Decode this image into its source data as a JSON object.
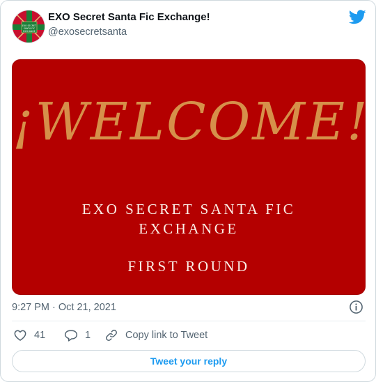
{
  "author": {
    "name": "EXO Secret Santa Fic Exchange!",
    "handle": "@exosecretsanta",
    "avatar_label": "EXO SECRET SANTA FIC EXCHANGE"
  },
  "media": {
    "headline": "¡WELCOME!",
    "line1": "EXO SECRET SANTA FIC",
    "line2": "EXCHANGE",
    "line3": "FIRST ROUND",
    "background_color": "#b40000",
    "headline_color": "#d6904a"
  },
  "meta": {
    "timestamp": "9:27 PM · Oct 21, 2021"
  },
  "actions": {
    "likes": "41",
    "replies": "1",
    "copy_link": "Copy link to Tweet"
  },
  "reply_button": "Tweet your reply",
  "colors": {
    "brand_blue": "#1d9bf0",
    "like_red": "#f91880",
    "muted": "#536471"
  }
}
